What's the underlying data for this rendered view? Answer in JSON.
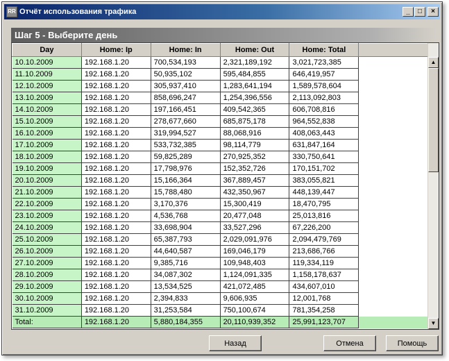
{
  "window": {
    "title": "Отчёт использования трафика",
    "icon_text": "RR"
  },
  "step": {
    "title": "Шаг 5 - Выберите день"
  },
  "table": {
    "columns": [
      "Day",
      "Home: Ip",
      "Home: In",
      "Home: Out",
      "Home: Total"
    ],
    "rows": [
      [
        "10.10.2009",
        "192.168.1.20",
        "700,534,193",
        "2,321,189,192",
        "3,021,723,385"
      ],
      [
        "11.10.2009",
        "192.168.1.20",
        "50,935,102",
        "595,484,855",
        "646,419,957"
      ],
      [
        "12.10.2009",
        "192.168.1.20",
        "305,937,410",
        "1,283,641,194",
        "1,589,578,604"
      ],
      [
        "13.10.2009",
        "192.168.1.20",
        "858,696,247",
        "1,254,396,556",
        "2,113,092,803"
      ],
      [
        "14.10.2009",
        "192.168.1.20",
        "197,166,451",
        "409,542,365",
        "606,708,816"
      ],
      [
        "15.10.2009",
        "192.168.1.20",
        "278,677,660",
        "685,875,178",
        "964,552,838"
      ],
      [
        "16.10.2009",
        "192.168.1.20",
        "319,994,527",
        "88,068,916",
        "408,063,443"
      ],
      [
        "17.10.2009",
        "192.168.1.20",
        "533,732,385",
        "98,114,779",
        "631,847,164"
      ],
      [
        "18.10.2009",
        "192.168.1.20",
        "59,825,289",
        "270,925,352",
        "330,750,641"
      ],
      [
        "19.10.2009",
        "192.168.1.20",
        "17,798,976",
        "152,352,726",
        "170,151,702"
      ],
      [
        "20.10.2009",
        "192.168.1.20",
        "15,166,364",
        "367,889,457",
        "383,055,821"
      ],
      [
        "21.10.2009",
        "192.168.1.20",
        "15,788,480",
        "432,350,967",
        "448,139,447"
      ],
      [
        "22.10.2009",
        "192.168.1.20",
        "3,170,376",
        "15,300,419",
        "18,470,795"
      ],
      [
        "23.10.2009",
        "192.168.1.20",
        "4,536,768",
        "20,477,048",
        "25,013,816"
      ],
      [
        "24.10.2009",
        "192.168.1.20",
        "33,698,904",
        "33,527,296",
        "67,226,200"
      ],
      [
        "25.10.2009",
        "192.168.1.20",
        "65,387,793",
        "2,029,091,976",
        "2,094,479,769"
      ],
      [
        "26.10.2009",
        "192.168.1.20",
        "44,640,587",
        "169,046,179",
        "213,686,766"
      ],
      [
        "27.10.2009",
        "192.168.1.20",
        "9,385,716",
        "109,948,403",
        "119,334,119"
      ],
      [
        "28.10.2009",
        "192.168.1.20",
        "34,087,302",
        "1,124,091,335",
        "1,158,178,637"
      ],
      [
        "29.10.2009",
        "192.168.1.20",
        "13,534,525",
        "421,072,485",
        "434,607,010"
      ],
      [
        "30.10.2009",
        "192.168.1.20",
        "2,394,833",
        "9,606,935",
        "12,001,768"
      ],
      [
        "31.10.2009",
        "192.168.1.20",
        "31,253,584",
        "750,100,674",
        "781,354,258"
      ]
    ],
    "total": [
      "Total:",
      "192.168.1.20",
      "5,880,184,355",
      "20,110,939,352",
      "25,991,123,707"
    ]
  },
  "buttons": {
    "back": "Назад",
    "cancel": "Отмена",
    "help": "Помощь"
  },
  "title_buttons": {
    "minimize": "_",
    "maximize": "□",
    "close": "×"
  },
  "scroll": {
    "up": "▲",
    "down": "▼"
  },
  "colors": {
    "day_cell": "#c8f5c8",
    "total_row": "#b7ecb7",
    "titlebar": "#0a246a"
  }
}
